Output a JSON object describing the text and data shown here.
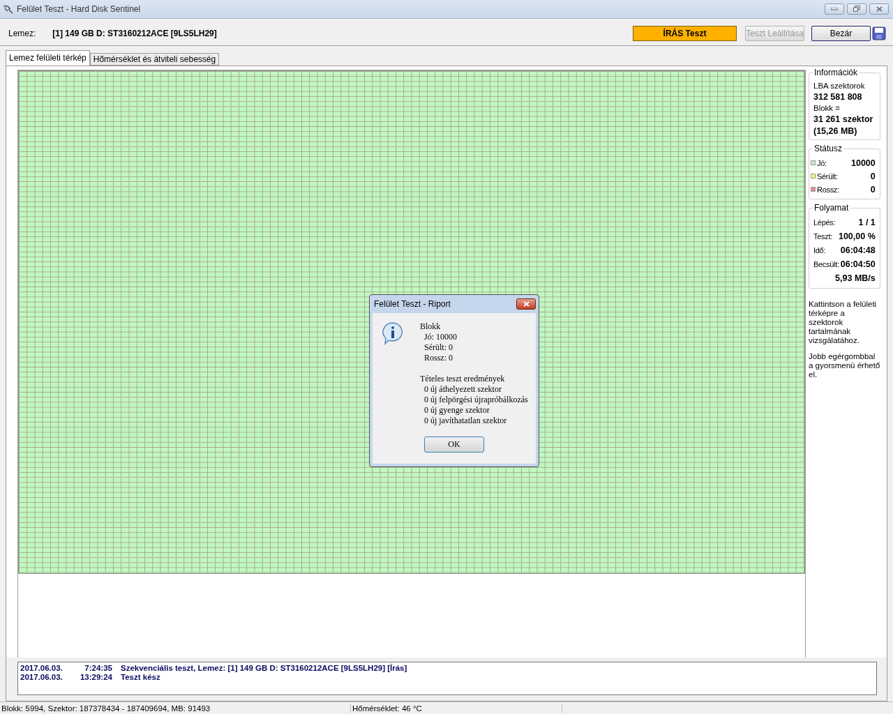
{
  "window": {
    "title": "Felület Teszt - Hard Disk Sentinel"
  },
  "disk": {
    "label": "Lemez:",
    "value": "[1] 149 GB D: ST3160212ACE [9LS5LH29]"
  },
  "test_mode": "ÍRÁS Teszt",
  "buttons": [
    {
      "label": "Teszt Leállítása",
      "disabled": true
    },
    {
      "label": "Bezár",
      "disabled": false
    }
  ],
  "tabs": [
    {
      "label": "Lemez felületi térkép",
      "selected": true
    },
    {
      "label": "Hőmérséklet és átviteli sebesség",
      "selected": false
    }
  ],
  "info": {
    "title": "Információk",
    "lines": [
      {
        "text": "LBA szektorok",
        "bold": false
      },
      {
        "text": "312 581 808",
        "bold": true
      },
      {
        "text": "Blokk =",
        "bold": false
      },
      {
        "text": "31 261 szektor",
        "bold": true
      },
      {
        "text": "(15,26 MB)",
        "bold": true
      }
    ]
  },
  "status": {
    "title": "Státusz",
    "items": [
      {
        "label": "Jó:",
        "value": "10000",
        "color": "#c8e8c8"
      },
      {
        "label": "Sérült:",
        "value": "0",
        "color": "#f0f080"
      },
      {
        "label": "Rossz:",
        "value": "0",
        "color": "#e88898"
      }
    ]
  },
  "progress": {
    "title": "Folyamat",
    "rows": [
      {
        "label": "Lépés:",
        "value": "1 / 1"
      },
      {
        "label": "Teszt:",
        "value": "100,00 %"
      },
      {
        "label": "Idő:",
        "value": "06:04:48"
      },
      {
        "label": "Becsült:",
        "value": "06:04:50"
      },
      {
        "value": "5,93 MB/s"
      }
    ]
  },
  "hints": [
    "Kattintson a felületi térképre a szektorok tartalmának vizsgálatához.",
    "Jobb egérgombbal a gyorsmenü érhető el."
  ],
  "dialog": {
    "title": "Felület Teszt - Riport",
    "sections": [
      [
        "Blokk",
        "  Jó: 10000",
        "  Sérült: 0",
        "  Rossz: 0"
      ],
      [
        "Tételes teszt eredmények",
        "  0 új áthelyezett szektor",
        "  0 új felpörgési újrapróbálkozás",
        "  0 új gyenge szektor",
        "  0 új javíthatatlan szektor"
      ]
    ],
    "button": "OK"
  },
  "log": [
    {
      "date": "2017.06.03.",
      "time": "7:24:35",
      "message": "Szekvenciális teszt, Lemez: [1] 149 GB D: ST3160212ACE [9LS5LH29] [Írás]"
    },
    {
      "date": "2017.06.03.",
      "time": "13:29:24",
      "message": "Teszt kész"
    }
  ],
  "status_bar": [
    "Blokk: 5994, Szektor: 187378434 - 187409694, MB: 91493",
    "Hőmérséklet: 46  °C"
  ]
}
